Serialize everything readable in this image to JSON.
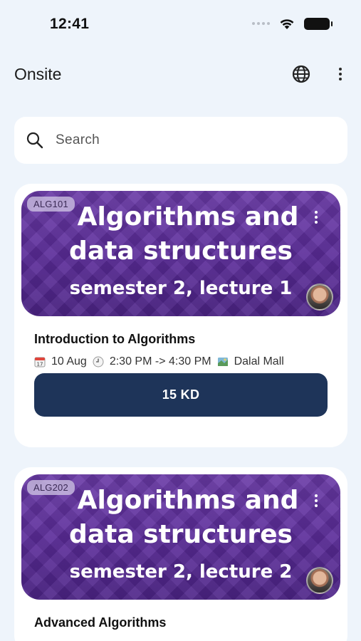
{
  "status_bar": {
    "time": "12:41"
  },
  "app_bar": {
    "title": "Onsite"
  },
  "search": {
    "placeholder": "Search"
  },
  "courses": [
    {
      "code": "ALG101",
      "banner_line1": "Algorithms and",
      "banner_line2": "data structures",
      "banner_line3": "semester 2, lecture 1",
      "title": "Introduction to Algorithms",
      "date": "10 Aug",
      "time": "2:30 PM -> 4:30 PM",
      "location": "Dalal Mall",
      "price": "15 KD"
    },
    {
      "code": "ALG202",
      "banner_line1": "Algorithms and",
      "banner_line2": "data structures",
      "banner_line3": "semester 2, lecture 2",
      "title": "Advanced Algorithms"
    }
  ],
  "colors": {
    "background": "#eef4fb",
    "banner_purple": "#5a2b98",
    "price_button": "#1e3459"
  },
  "icons": [
    "wifi-icon",
    "battery-icon",
    "globe-icon",
    "more-vert-icon",
    "search-icon",
    "calendar-icon",
    "clock-icon",
    "map-icon",
    "avatar"
  ]
}
